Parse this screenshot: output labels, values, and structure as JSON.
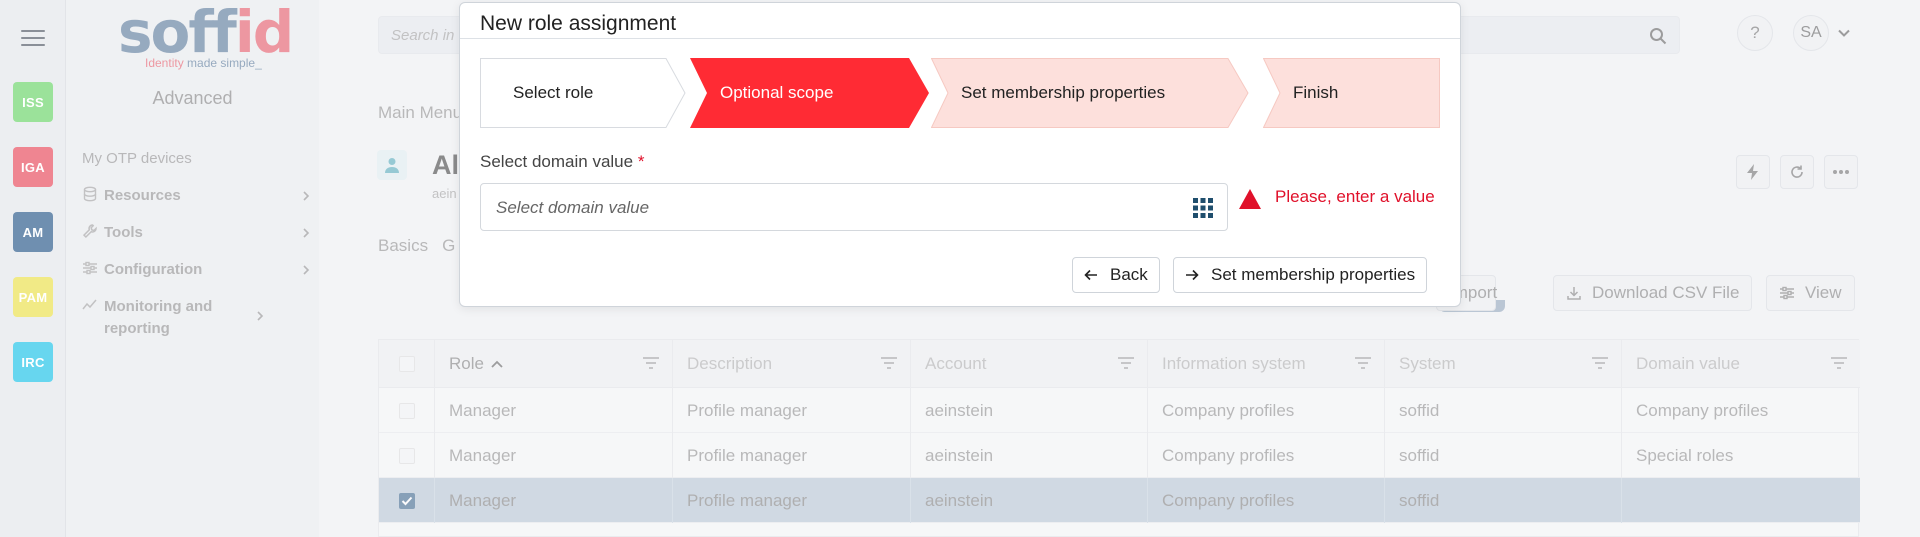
{
  "rail": {
    "apps": [
      {
        "label": "ISS",
        "color": "#9be29a"
      },
      {
        "label": "IGA",
        "color": "#ef8591"
      },
      {
        "label": "AM",
        "color": "#6f8fb0"
      },
      {
        "label": "PAM",
        "color": "#f1ea86"
      },
      {
        "label": "IRC",
        "color": "#67d6ef"
      }
    ]
  },
  "sidebar": {
    "logo": {
      "word_a": "soff",
      "word_b": "id",
      "tag_a": "Identity",
      "tag_b": "made simple_"
    },
    "section": "Advanced",
    "items": [
      {
        "label": "My OTP devices"
      },
      {
        "label": "Resources",
        "icon": "database-icon"
      },
      {
        "label": "Tools",
        "icon": "wrench-icon"
      },
      {
        "label": "Configuration",
        "icon": "sliders-icon"
      },
      {
        "label": "Monitoring and reporting",
        "icon": "chart-line-icon"
      }
    ]
  },
  "header": {
    "search_placeholder": "Search in",
    "help": "?",
    "user_initials": "SA"
  },
  "page": {
    "breadcrumb": "Main Menu",
    "title": "Al",
    "subtitle": "aein",
    "tabs_visible": [
      "Basics",
      "G"
    ]
  },
  "toolbar": {
    "import": "Import",
    "download": "Download CSV File",
    "view": "View"
  },
  "grid": {
    "columns": [
      "Role",
      "Description",
      "Account",
      "Information system",
      "System",
      "Domain value"
    ],
    "rows": [
      {
        "checked": false,
        "cells": [
          "Manager",
          "Profile manager",
          "aeinstein",
          "Company profiles",
          "soffid",
          "Company profiles"
        ]
      },
      {
        "checked": false,
        "cells": [
          "Manager",
          "Profile manager",
          "aeinstein",
          "Company profiles",
          "soffid",
          "Special roles"
        ]
      },
      {
        "checked": true,
        "cells": [
          "Manager",
          "Profile manager",
          "aeinstein",
          "Company profiles",
          "soffid",
          ""
        ]
      }
    ]
  },
  "dialog": {
    "title": "New role assignment",
    "steps": [
      {
        "label": "Select role",
        "state": "done"
      },
      {
        "label": "Optional scope",
        "state": "active"
      },
      {
        "label": "Set membership properties",
        "state": "pending"
      },
      {
        "label": "Finish",
        "state": "pending"
      }
    ],
    "field_label": "Select domain value",
    "required_mark": "*",
    "field_placeholder": "Select domain value",
    "error": "Please, enter a value",
    "back": "Back",
    "next": "Set membership properties"
  },
  "colors": {
    "active_step": "#ff2b34",
    "pending_step": "#fde0dc",
    "error": "#e0102a",
    "selected_row": "#b3c3d3"
  }
}
